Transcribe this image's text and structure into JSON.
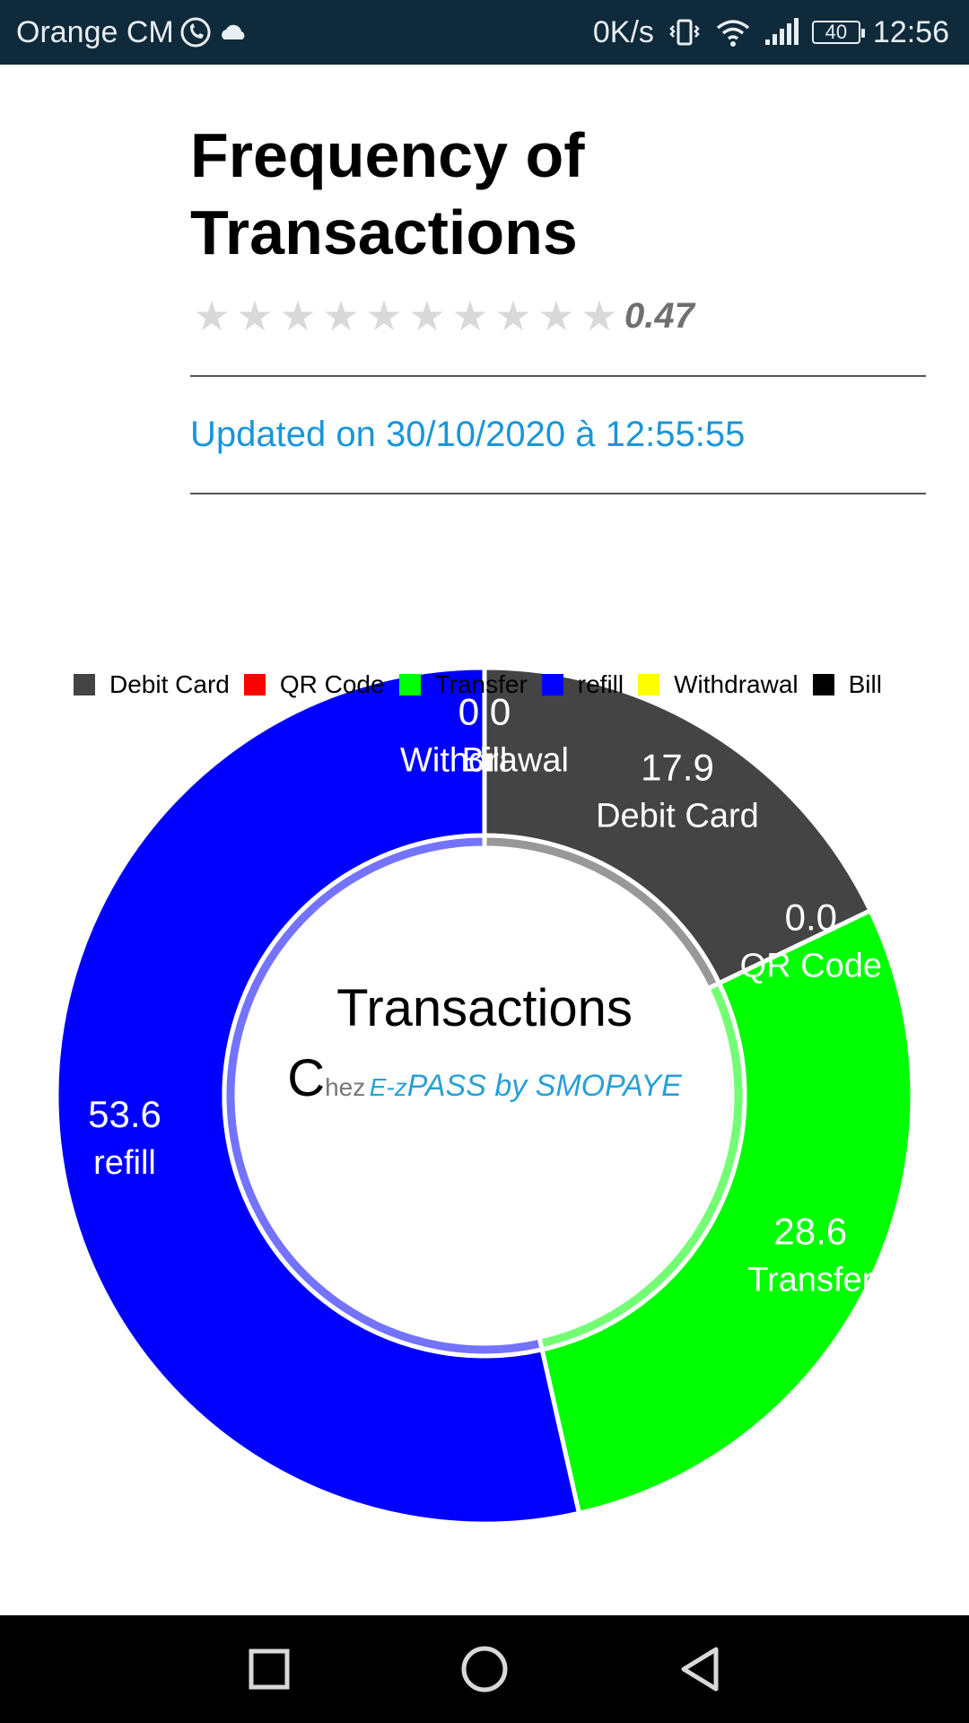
{
  "status_bar": {
    "carrier": "Orange CM",
    "network_speed": "0K/s",
    "battery": "40",
    "time": "12:56",
    "icons": [
      "phone-call-icon",
      "cloud-icon",
      "vibrate-icon",
      "wifi-icon",
      "signal-icon",
      "battery-icon"
    ]
  },
  "header": {
    "title_line1": "Frequency of",
    "title_line2": "Transactions",
    "rating": {
      "value": 0.47,
      "max_stars": 10,
      "label": "0.47"
    },
    "updated": "Updated on 30/10/2020 à 12:55:55"
  },
  "chart_data": {
    "type": "pie",
    "variant": "donut",
    "legend_position": "top",
    "categories": [
      "Debit Card",
      "QR Code",
      "Transfer",
      "refill",
      "Withdrawal",
      "Bill"
    ],
    "values": [
      17.9,
      0.0,
      28.6,
      53.6,
      0.0,
      0.0
    ],
    "value_labels": [
      "17.9",
      "0.0",
      "28.6",
      "53.6",
      "0.0",
      "0.0"
    ],
    "colors": [
      "#444444",
      "#ff0000",
      "#00ff00",
      "#0000ff",
      "#ffff00",
      "#000000"
    ],
    "center_title": "Transactions",
    "center_subtitle": {
      "big_c": "C",
      "rest": "hez",
      "brand_small": "E-z",
      "brand": "PASS by SMOPAYE"
    }
  },
  "nav_bar": {
    "icons": [
      "recent-apps-icon",
      "home-icon",
      "back-icon"
    ]
  }
}
